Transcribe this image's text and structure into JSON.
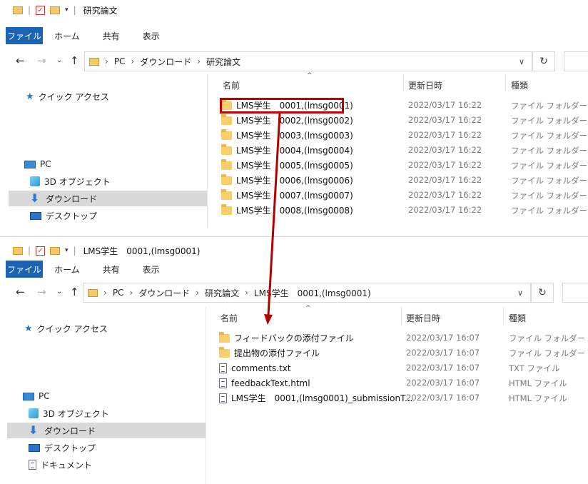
{
  "windows": [
    {
      "title": "研究論文",
      "ribbon": {
        "file": "ファイル",
        "home": "ホーム",
        "share": "共有",
        "view": "表示"
      },
      "address": {
        "crumbs": [
          "PC",
          "ダウンロード",
          "研究論文"
        ]
      },
      "columns": {
        "name": "名前",
        "date": "更新日時",
        "type": "種類"
      },
      "sidebar": [
        {
          "label": "クイック アクセス",
          "icon": "quick-access-star-icon"
        },
        {
          "label": "PC",
          "icon": "pc-icon"
        },
        {
          "label": "3D オブジェクト",
          "icon": "3d-objects-icon"
        },
        {
          "label": "ダウンロード",
          "icon": "download-icon",
          "selected": true
        },
        {
          "label": "デスクトップ",
          "icon": "desktop-icon"
        }
      ],
      "rows": [
        {
          "name": "LMS学生　0001,(lmsg0001)",
          "date": "2022/03/17 16:22",
          "type": "ファイル フォルダー",
          "icon": "folder-icon"
        },
        {
          "name": "LMS学生　0002,(lmsg0002)",
          "date": "2022/03/17 16:22",
          "type": "ファイル フォルダー",
          "icon": "folder-icon"
        },
        {
          "name": "LMS学生　0003,(lmsg0003)",
          "date": "2022/03/17 16:22",
          "type": "ファイル フォルダー",
          "icon": "folder-icon"
        },
        {
          "name": "LMS学生　0004,(lmsg0004)",
          "date": "2022/03/17 16:22",
          "type": "ファイル フォルダー",
          "icon": "folder-icon"
        },
        {
          "name": "LMS学生　0005,(lmsg0005)",
          "date": "2022/03/17 16:22",
          "type": "ファイル フォルダー",
          "icon": "folder-icon"
        },
        {
          "name": "LMS学生　0006,(lmsg0006)",
          "date": "2022/03/17 16:22",
          "type": "ファイル フォルダー",
          "icon": "folder-icon"
        },
        {
          "name": "LMS学生　0007,(lmsg0007)",
          "date": "2022/03/17 16:22",
          "type": "ファイル フォルダー",
          "icon": "folder-icon"
        },
        {
          "name": "LMS学生　0008,(lmsg0008)",
          "date": "2022/03/17 16:22",
          "type": "ファイル フォルダー",
          "icon": "folder-icon"
        }
      ]
    },
    {
      "title": "LMS学生　0001,(lmsg0001)",
      "ribbon": {
        "file": "ファイル",
        "home": "ホーム",
        "share": "共有",
        "view": "表示"
      },
      "address": {
        "crumbs": [
          "PC",
          "ダウンロード",
          "研究論文",
          "LMS学生　0001,(lmsg0001)"
        ]
      },
      "columns": {
        "name": "名前",
        "date": "更新日時",
        "type": "種類"
      },
      "sidebar": [
        {
          "label": "クイック アクセス",
          "icon": "quick-access-star-icon"
        },
        {
          "label": "PC",
          "icon": "pc-icon"
        },
        {
          "label": "3D オブジェクト",
          "icon": "3d-objects-icon"
        },
        {
          "label": "ダウンロード",
          "icon": "download-icon",
          "selected": true
        },
        {
          "label": "デスクトップ",
          "icon": "desktop-icon"
        },
        {
          "label": "ドキュメント",
          "icon": "documents-icon"
        }
      ],
      "rows": [
        {
          "name": "フィードバックの添付ファイル",
          "date": "2022/03/17 16:07",
          "type": "ファイル フォルダー",
          "icon": "folder-icon"
        },
        {
          "name": "提出物の添付ファイル",
          "date": "2022/03/17 16:07",
          "type": "ファイル フォルダー",
          "icon": "folder-icon"
        },
        {
          "name": "comments.txt",
          "date": "2022/03/17 16:07",
          "type": "TXT ファイル",
          "icon": "text-file-icon"
        },
        {
          "name": "feedbackText.html",
          "date": "2022/03/17 16:07",
          "type": "HTML ファイル",
          "icon": "html-file-icon"
        },
        {
          "name": "LMS学生　0001,(lmsg0001)_submissionT...",
          "date": "2022/03/17 16:07",
          "type": "HTML ファイル",
          "icon": "html-file-icon"
        }
      ]
    }
  ],
  "colors": {
    "ribbon_file_bg": "#1a63b5",
    "highlight_box": "#c00000",
    "arrow": "#b00000",
    "selected_bg": "#d9d9d9",
    "folder": "#f7ce6b"
  }
}
